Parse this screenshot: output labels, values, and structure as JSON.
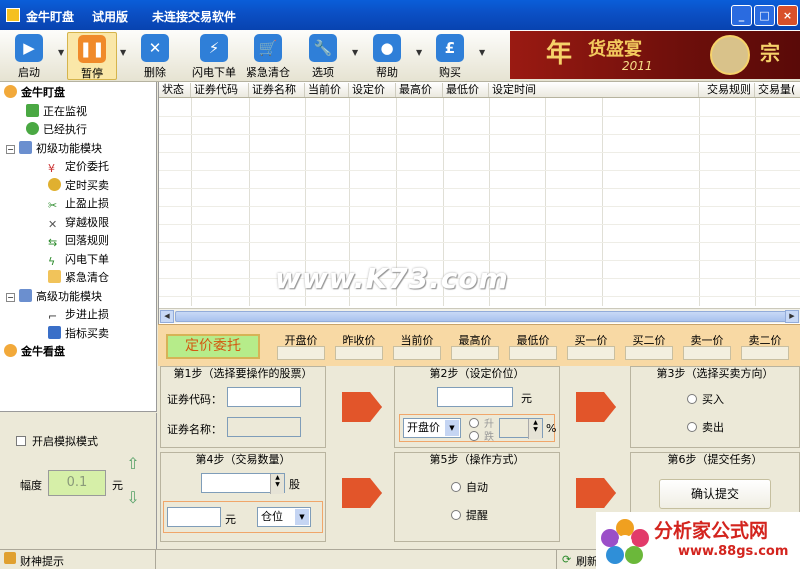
{
  "window": {
    "title": "金牛盯盘",
    "edition": "试用版",
    "connection": "未连接交易软件",
    "min": "_",
    "max": "□",
    "close": "×"
  },
  "toolbar": {
    "start": "启动",
    "pause": "暂停",
    "delete": "删除",
    "flash_order": "闪电下单",
    "emergency_clear": "紧急清仓",
    "options": "选项",
    "help": "帮助",
    "buy": "购买"
  },
  "banner": {
    "big": "年",
    "text": "货盛宴",
    "year": "2011",
    "right": "宗"
  },
  "tree": {
    "root": "金牛盯盘",
    "monitoring": "正在监视",
    "executed": "已经执行",
    "basic_module": "初级功能模块",
    "basic_items": [
      "定价委托",
      "定时买卖",
      "止盈止损",
      "穿越极限",
      "回落规则",
      "闪电下单",
      "紧急清仓"
    ],
    "advanced_module": "高级功能模块",
    "advanced_items": [
      "步进止损",
      "指标买卖"
    ],
    "watch": "金牛看盘"
  },
  "sim": {
    "checkbox_label": "开启模拟模式",
    "range_label": "幅度",
    "range_value": "0.1",
    "unit": "元"
  },
  "grid": {
    "columns": [
      "状态",
      "证券代码",
      "证券名称",
      "当前价",
      "设定价",
      "最高价",
      "最低价",
      "设定时间",
      "交易规则",
      "交易量("
    ]
  },
  "watermark": "www.K73.com",
  "quote": {
    "mode": "定价委托",
    "labels": [
      "开盘价",
      "昨收价",
      "当前价",
      "最高价",
      "最低价",
      "买一价",
      "买二价",
      "卖一价",
      "卖二价"
    ]
  },
  "steps": {
    "step1": {
      "title": "第1步（选择要操作的股票）",
      "code_label": "证券代码：",
      "name_label": "证券名称："
    },
    "step2": {
      "title": "第2步（设定价位）",
      "unit": "元",
      "price_select": "开盘价",
      "up": "升",
      "down": "跌",
      "pct": "%"
    },
    "step3": {
      "title": "第3步（选择买卖方向）",
      "buy": "买入",
      "sell": "卖出"
    },
    "step4": {
      "title": "第4步（交易数量）",
      "share_unit": "股",
      "yuan_unit": "元",
      "position_select": "仓位"
    },
    "step5": {
      "title": "第5步（操作方式）",
      "auto": "自动",
      "remind": "提醒"
    },
    "step6": {
      "title": "第6步（提交任务）",
      "confirm": "确认提交"
    }
  },
  "status": {
    "tip": "财神提示",
    "refresh": "刷新"
  },
  "logo": {
    "text": "分析家公式网",
    "url": "www.88gs.com"
  }
}
